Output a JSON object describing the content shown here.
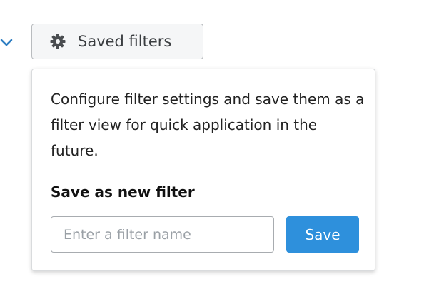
{
  "toolbar": {
    "saved_filters_label": "Saved filters",
    "saved_filters_icon": "gear-icon",
    "expand_icon": "chevron-down-icon",
    "expand_icon_color": "#2e7ec2"
  },
  "popover": {
    "description": "Configure filter settings and save them as a filter view for quick application in the future.",
    "heading": "Save as new filter",
    "input": {
      "value": "",
      "placeholder": "Enter a filter name"
    },
    "save_label": "Save",
    "save_color": "#2e90dc"
  }
}
